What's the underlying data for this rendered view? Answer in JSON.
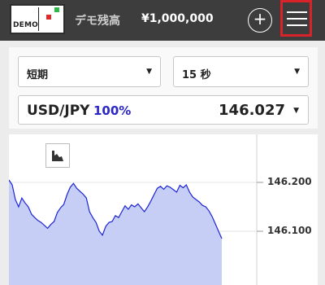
{
  "header": {
    "logo_text": "DEMO",
    "balance_label": "デモ残高",
    "balance_value": "¥1,000,000",
    "add_symbol": "+"
  },
  "controls": {
    "period": "短期",
    "interval": "15 秒",
    "arrow": "▼"
  },
  "pair": {
    "symbol": "USD/JPY",
    "percent": "100%",
    "price": "146.027"
  },
  "chart": {
    "y_ticks": [
      "146.200",
      "146.100"
    ]
  },
  "chart_data": {
    "type": "area",
    "title": "",
    "xlabel": "",
    "ylabel": "",
    "ylim": [
      146.085,
      146.25
    ],
    "y_ticks": [
      146.2,
      146.1
    ],
    "grid": true,
    "series": [
      {
        "values": [
          146.205,
          146.195,
          146.165,
          146.15,
          146.168,
          146.158,
          146.15,
          146.135,
          146.128,
          146.122,
          146.118,
          146.112,
          146.106,
          146.114,
          146.12,
          146.138,
          146.148,
          146.155,
          146.175,
          146.19,
          146.198,
          146.188,
          146.182,
          146.176,
          146.168,
          146.14,
          146.128,
          146.118,
          146.1,
          146.092,
          146.11,
          146.118,
          146.12,
          146.132,
          146.128,
          146.14,
          146.152,
          146.145,
          146.154,
          146.15,
          146.156,
          146.148,
          146.14,
          146.15,
          146.162,
          146.175,
          146.188,
          146.192,
          146.186,
          146.193,
          146.19,
          146.185,
          146.18,
          146.194,
          146.189,
          146.195,
          146.18,
          146.17,
          146.165,
          146.16,
          146.153,
          146.15,
          146.142,
          146.13,
          146.115,
          146.1,
          146.085
        ]
      }
    ]
  },
  "colors": {
    "topbar": "#3d3d3d",
    "menu_highlight": "#d8232a",
    "percent_blue": "#2a27c6",
    "line": "#1c24d6",
    "area_fill": "#c6cef5"
  },
  "icons": [
    "chart-type-icon",
    "menu-icon",
    "add-icon"
  ]
}
